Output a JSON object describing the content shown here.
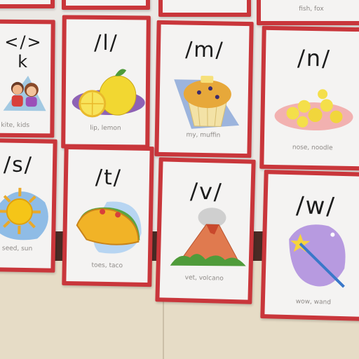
{
  "cards": [
    {
      "sound": "",
      "caption": ""
    },
    {
      "sound": "",
      "caption": ""
    },
    {
      "sound": "",
      "caption": ""
    },
    {
      "sound": "",
      "caption": "fish, fox"
    },
    {
      "sound": "</> k",
      "caption": "kite, kids"
    },
    {
      "sound": "/l/",
      "caption": "lip, lemon"
    },
    {
      "sound": "/m/",
      "caption": "my, muffin"
    },
    {
      "sound": "/n/",
      "caption": "nose, noodle"
    },
    {
      "sound": "/s/",
      "caption": "seed, sun"
    },
    {
      "sound": "/t/",
      "caption": "toes, taco"
    },
    {
      "sound": "/v/",
      "caption": "vet, volcano"
    },
    {
      "sound": "/w/",
      "caption": "wow, wand"
    }
  ],
  "pictures": [
    "kids-picture",
    "lemon-picture",
    "muffin-picture",
    "noodles-picture",
    "sun-picture",
    "taco-picture",
    "volcano-picture",
    "wand-picture"
  ],
  "colors": {
    "card_border": "#c9363b",
    "card_face": "#f4f3f2",
    "wall": "#ebe8e4",
    "board": "#4a2b25"
  }
}
